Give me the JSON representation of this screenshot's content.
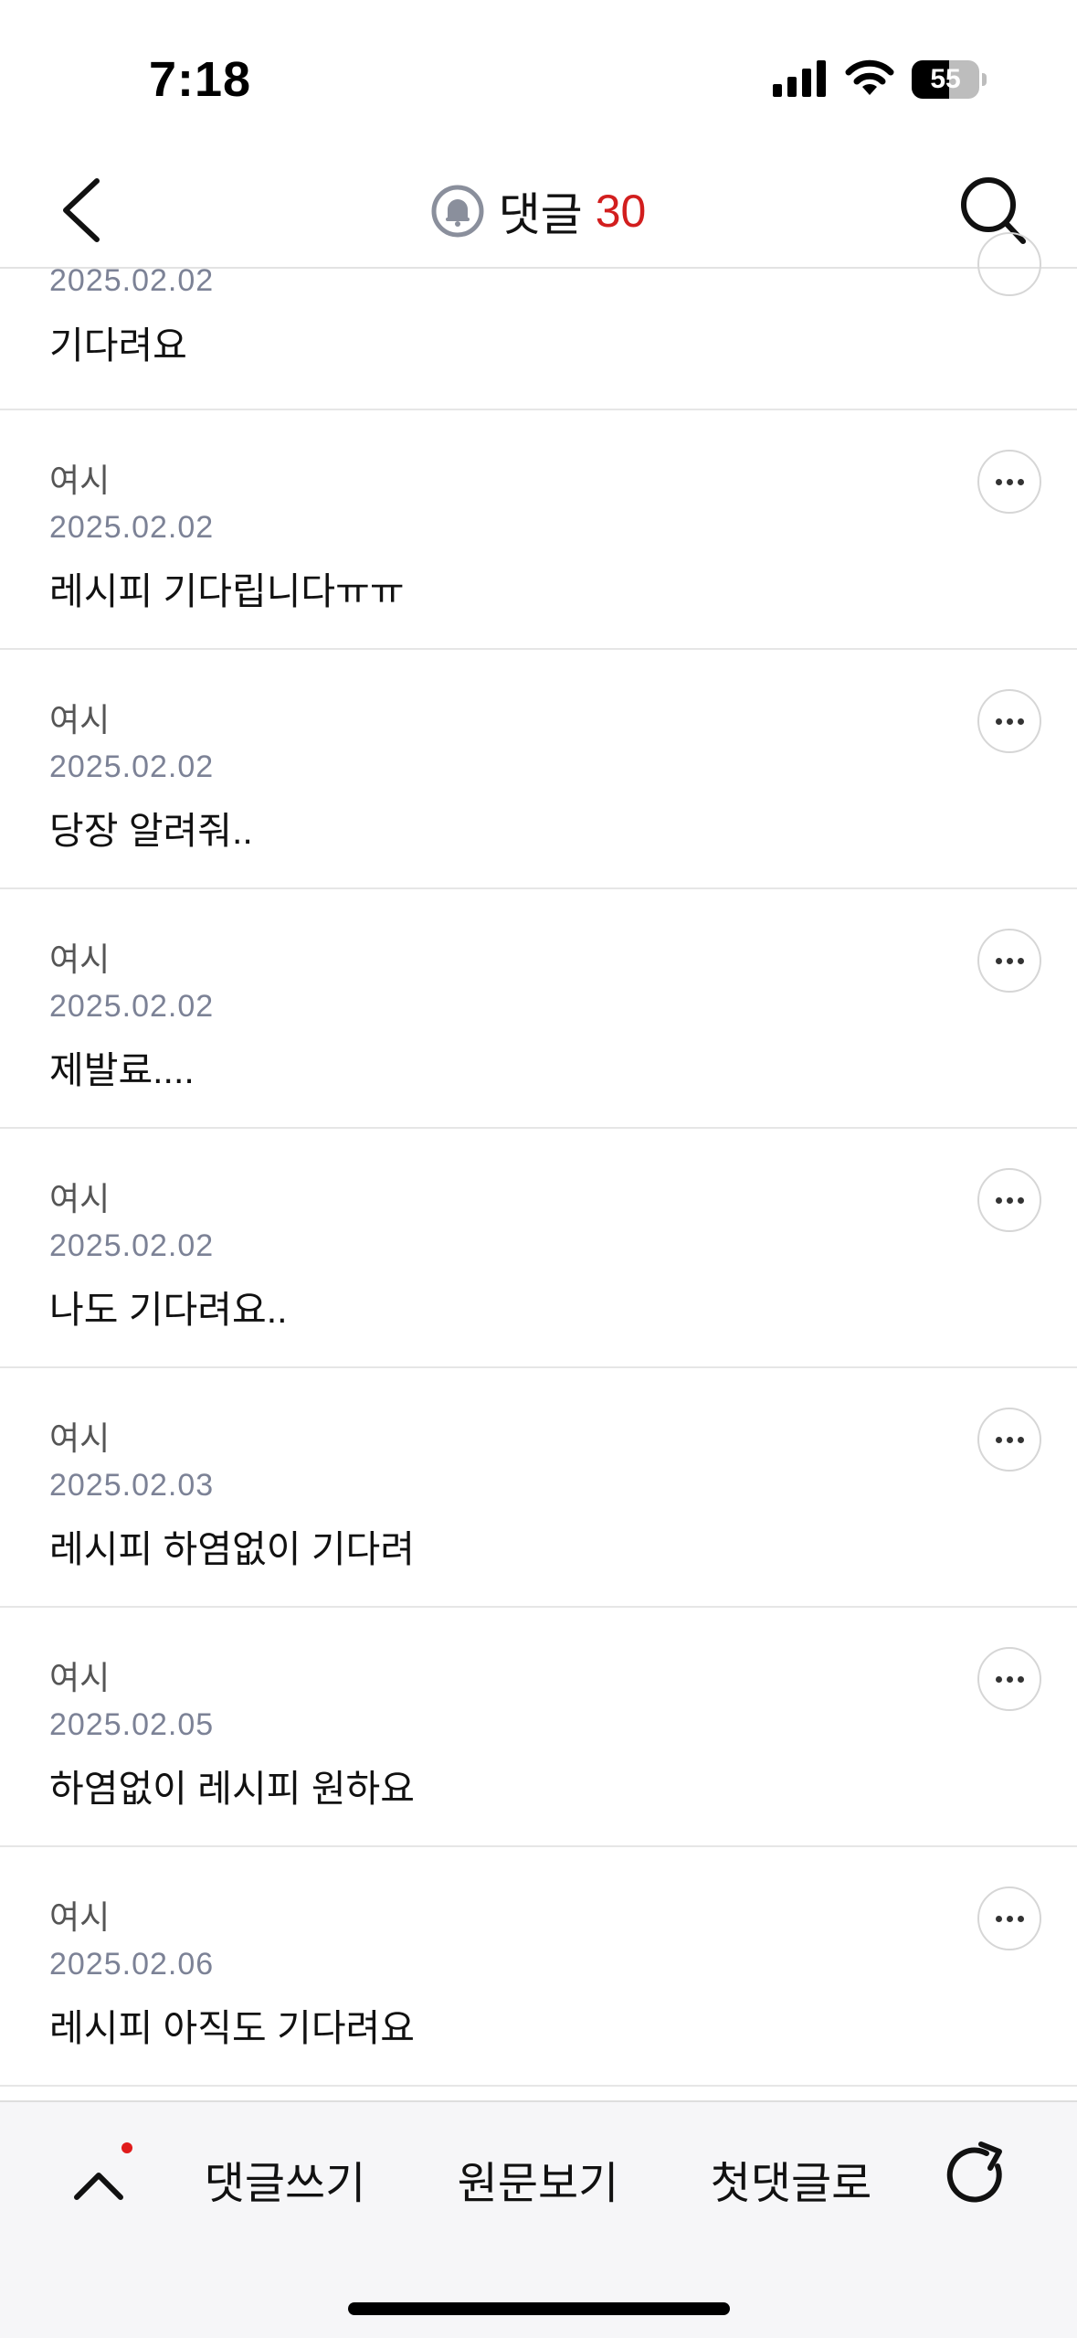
{
  "status_bar": {
    "time": "7:18",
    "battery": "55",
    "battery_level": 0.55
  },
  "header": {
    "title": "댓글",
    "count": "30"
  },
  "comments": [
    {
      "author": "",
      "date": "2025.02.02",
      "text": "기다려요"
    },
    {
      "author": "여시",
      "date": "2025.02.02",
      "text": "레시피 기다립니다ㅠㅠ"
    },
    {
      "author": "여시",
      "date": "2025.02.02",
      "text": "당장 알려줘.."
    },
    {
      "author": "여시",
      "date": "2025.02.02",
      "text": "제발료...."
    },
    {
      "author": "여시",
      "date": "2025.02.02",
      "text": "나도 기다려요.."
    },
    {
      "author": "여시",
      "date": "2025.02.03",
      "text": "레시피 하염없이 기다려"
    },
    {
      "author": "여시",
      "date": "2025.02.05",
      "text": "하염없이 레시피 원하요"
    },
    {
      "author": "여시",
      "date": "2025.02.06",
      "text": "레시피 아직도 기다려요"
    }
  ],
  "bottom_bar": {
    "write_label": "댓글쓰기",
    "original_label": "원문보기",
    "first_label": "첫댓글로"
  },
  "colors": {
    "accent": "#d21e1e",
    "date": "#7c8296",
    "divider": "#e6e6e6"
  }
}
